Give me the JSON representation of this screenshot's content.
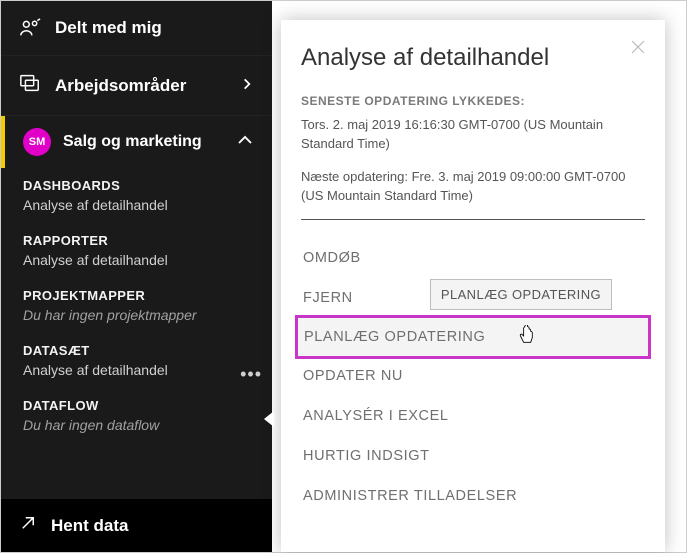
{
  "sidebar": {
    "shared_label": "Delt med mig",
    "workspaces_label": "Arbejdsområder",
    "active_workspace": {
      "initials": "SM",
      "name": "Salg og marketing"
    },
    "sections": [
      {
        "head": "DASHBOARDS",
        "item": "Analyse af detailhandel",
        "italic": false
      },
      {
        "head": "RAPPORTER",
        "item": "Analyse af detailhandel",
        "italic": false
      },
      {
        "head": "PROJEKTMAPPER",
        "item": "Du har ingen projektmapper",
        "italic": true
      },
      {
        "head": "DATASÆT",
        "item": "Analyse af detailhandel",
        "italic": false,
        "more": true
      },
      {
        "head": "DATAFLOW",
        "item": "Du har ingen dataflow",
        "italic": true
      }
    ],
    "getdata_label": "Hent data"
  },
  "panel": {
    "title": "Analyse af detailhandel",
    "status_head": "SENESTE OPDATERING LYKKEDES:",
    "status_time": "Tors. 2. maj 2019 16:16:30 GMT-0700 (US Mountain Standard Time)",
    "next_time": "Næste opdatering: Fre. 3. maj 2019 09:00:00 GMT-0700 (US Mountain Standard Time)",
    "menu": {
      "rename": "OMDØB",
      "remove": "FJERN",
      "schedule": "PLANLÆG OPDATERING",
      "refresh_now": "OPDATER NU",
      "analyze_excel": "ANALYSÉR I EXCEL",
      "quick_insights": "HURTIG INDSIGT",
      "manage_permissions": "ADMINISTRER TILLADELSER"
    },
    "tooltip": "PLANLÆG OPDATERING"
  }
}
